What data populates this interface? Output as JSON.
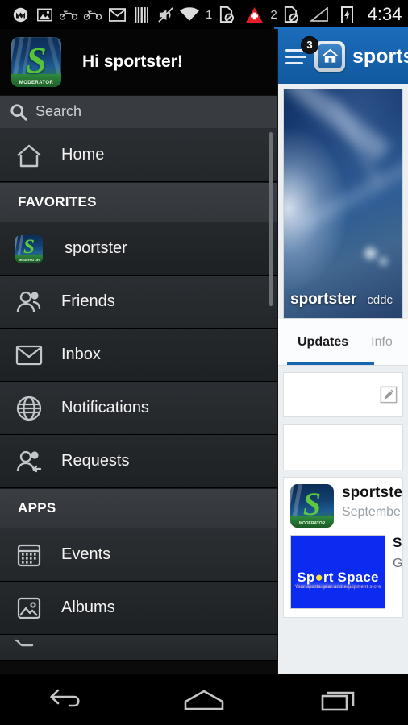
{
  "status_bar": {
    "icons": [
      {
        "name": "motorola-icon",
        "label": "Motorola"
      },
      {
        "name": "screenshot-icon",
        "label": "Screenshot"
      },
      {
        "name": "motorcycle-icon",
        "label": "Motorcycle"
      },
      {
        "name": "motorcycle-icon-2",
        "label": "Motorcycle"
      },
      {
        "name": "gmail-icon",
        "label": "Gmail"
      },
      {
        "name": "barcode-icon",
        "label": "Barcode"
      },
      {
        "name": "mute-icon",
        "label": "Silent mode"
      }
    ],
    "wifi_label": "wifi",
    "sim1_number": "1",
    "sim1_state": "no-sim",
    "alert_label": "alert",
    "sim2_number": "2",
    "sim2_state": "no-sim",
    "signal_label": "signal",
    "battery_label": "charging",
    "clock": "4:34"
  },
  "drawer": {
    "greeting": "Hi sportster!",
    "avatar": {
      "letter": "S",
      "tag": "MODERATOR"
    },
    "search": {
      "placeholder": "Search",
      "value": "",
      "icon": "search-icon"
    },
    "items": [
      {
        "type": "item",
        "label": "Home",
        "icon": "home-icon"
      },
      {
        "type": "section",
        "label": "FAVORITES"
      },
      {
        "type": "favorite",
        "label": "sportster",
        "icon": "sportster-thumb"
      },
      {
        "type": "item",
        "label": "Friends",
        "icon": "friends-icon"
      },
      {
        "type": "item",
        "label": "Inbox",
        "icon": "envelope-icon"
      },
      {
        "type": "item",
        "label": "Notifications",
        "icon": "globe-icon"
      },
      {
        "type": "item",
        "label": "Requests",
        "icon": "requests-icon"
      },
      {
        "type": "section",
        "label": "APPS"
      },
      {
        "type": "item",
        "label": "Events",
        "icon": "calendar-icon"
      },
      {
        "type": "item",
        "label": "Albums",
        "icon": "photo-icon"
      }
    ]
  },
  "action_bar": {
    "menu_badge": "3",
    "title": "sportst",
    "home_icon": "home-icon",
    "menu_icon": "hamburger-icon"
  },
  "content": {
    "cover": {
      "name": "sportster",
      "subtitle": "cddc"
    },
    "tabs": [
      {
        "label": "Updates",
        "active": true
      },
      {
        "label": "Info",
        "active": false
      }
    ],
    "compose_card": {
      "icon": "pencil-icon"
    },
    "post": {
      "author": "sportster",
      "date": "September",
      "attachment": {
        "banner_title": "Sport Space",
        "banner_tagline": "Your sports gear and equipment store",
        "title": "Sp",
        "description": "Get"
      }
    }
  },
  "nav_bar": {
    "back_label": "Back",
    "home_label": "Home",
    "recents_label": "Recent apps"
  },
  "colors": {
    "accent_blue": "#1565b0",
    "drawer_bg": "#23272a",
    "content_bg": "#eceff1",
    "badge_bg": "#141414",
    "brand_green": "#5ec93f"
  }
}
